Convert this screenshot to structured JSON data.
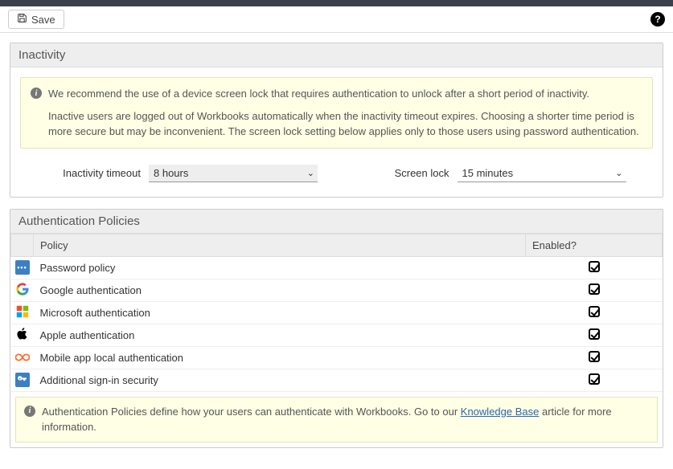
{
  "toolbar": {
    "save_label": "Save"
  },
  "inactivity": {
    "title": "Inactivity",
    "info_line1": "We recommend the use of a device screen lock that requires authentication to unlock after a short period of inactivity.",
    "info_line2": "Inactive users are logged out of Workbooks automatically when the inactivity timeout expires. Choosing a shorter time period is more secure but may be inconvenient. The screen lock setting below applies only to those users using password authentication.",
    "timeout_label": "Inactivity timeout",
    "timeout_value": "8 hours",
    "screenlock_label": "Screen lock",
    "screenlock_value": "15 minutes"
  },
  "auth": {
    "title": "Authentication Policies",
    "col_policy": "Policy",
    "col_enabled": "Enabled?",
    "rows": [
      {
        "icon": "dots",
        "label": "Password policy",
        "enabled": true
      },
      {
        "icon": "google",
        "label": "Google authentication",
        "enabled": true
      },
      {
        "icon": "microsoft",
        "label": "Microsoft authentication",
        "enabled": true
      },
      {
        "icon": "apple",
        "label": "Apple authentication",
        "enabled": true
      },
      {
        "icon": "infinity",
        "label": "Mobile app local authentication",
        "enabled": true
      },
      {
        "icon": "key",
        "label": "Additional sign-in security",
        "enabled": true
      }
    ],
    "footer_pre": "Authentication Policies define how your users can authenticate with Workbooks. Go to our ",
    "footer_link": "Knowledge Base",
    "footer_post": " article for more information."
  }
}
